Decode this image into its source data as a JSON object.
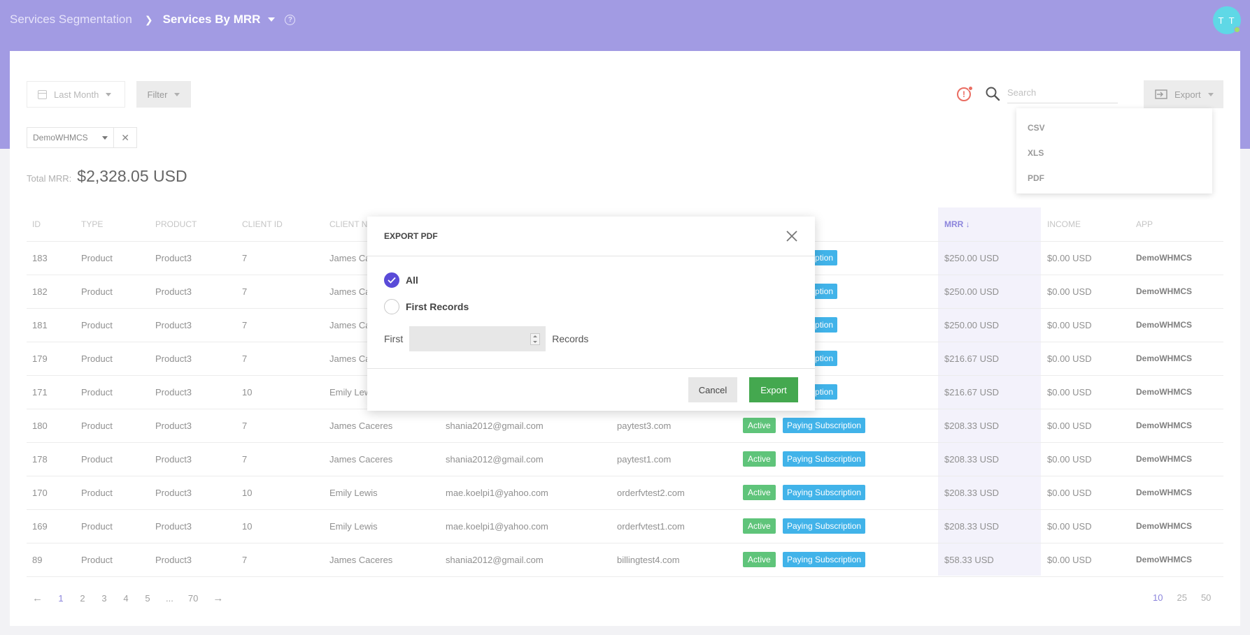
{
  "header": {
    "breadcrumb_parent": "Services Segmentation",
    "breadcrumb_current": "Services By MRR",
    "avatar_initials": "T T"
  },
  "toolbar": {
    "date_range": "Last Month",
    "filter_label": "Filter",
    "search_placeholder": "Search",
    "export_label": "Export",
    "export_options": [
      "CSV",
      "XLS",
      "PDF"
    ]
  },
  "filter_tag": {
    "label": "DemoWHMCS"
  },
  "summary": {
    "total_label": "Total MRR:",
    "total_value": "$2,328.05 USD"
  },
  "table": {
    "columns": [
      "ID",
      "TYPE",
      "PRODUCT",
      "CLIENT ID",
      "CLIENT N",
      "",
      "",
      "",
      "MRR",
      "INCOME",
      "APP"
    ],
    "rows": [
      [
        "183",
        "Product",
        "Product3",
        "7",
        "James Ca",
        "",
        "",
        "",
        "Subscription",
        "$250.00 USD",
        "$0.00 USD",
        "DemoWHMCS"
      ],
      [
        "182",
        "Product",
        "Product3",
        "7",
        "James Ca",
        "",
        "",
        "",
        "Subscription",
        "$250.00 USD",
        "$0.00 USD",
        "DemoWHMCS"
      ],
      [
        "181",
        "Product",
        "Product3",
        "7",
        "James Ca",
        "",
        "",
        "",
        "Subscription",
        "$250.00 USD",
        "$0.00 USD",
        "DemoWHMCS"
      ],
      [
        "179",
        "Product",
        "Product3",
        "7",
        "James Ca",
        "",
        "",
        "",
        "Subscription",
        "$216.67 USD",
        "$0.00 USD",
        "DemoWHMCS"
      ],
      [
        "171",
        "Product",
        "Product3",
        "10",
        "Emily Lew",
        "",
        "",
        "",
        "Subscription",
        "$216.67 USD",
        "$0.00 USD",
        "DemoWHMCS"
      ],
      [
        "180",
        "Product",
        "Product3",
        "7",
        "James Caceres",
        "shania2012@gmail.com",
        "paytest3.com",
        "Active",
        "Paying Subscription",
        "$208.33 USD",
        "$0.00 USD",
        "DemoWHMCS"
      ],
      [
        "178",
        "Product",
        "Product3",
        "7",
        "James Caceres",
        "shania2012@gmail.com",
        "paytest1.com",
        "Active",
        "Paying Subscription",
        "$208.33 USD",
        "$0.00 USD",
        "DemoWHMCS"
      ],
      [
        "170",
        "Product",
        "Product3",
        "10",
        "Emily Lewis",
        "mae.koelpi1@yahoo.com",
        "orderfvtest2.com",
        "Active",
        "Paying Subscription",
        "$208.33 USD",
        "$0.00 USD",
        "DemoWHMCS"
      ],
      [
        "169",
        "Product",
        "Product3",
        "10",
        "Emily Lewis",
        "mae.koelpi1@yahoo.com",
        "orderfvtest1.com",
        "Active",
        "Paying Subscription",
        "$208.33 USD",
        "$0.00 USD",
        "DemoWHMCS"
      ],
      [
        "89",
        "Product",
        "Product3",
        "7",
        "James Caceres",
        "shania2012@gmail.com",
        "billingtest4.com",
        "Active",
        "Paying Subscription",
        "$58.33 USD",
        "$0.00 USD",
        "DemoWHMCS"
      ]
    ]
  },
  "pagination": {
    "prev": "←",
    "pages": [
      "1",
      "2",
      "3",
      "4",
      "5",
      "...",
      "70"
    ],
    "next": "→",
    "page_sizes": [
      "10",
      "25",
      "50"
    ]
  },
  "modal": {
    "title": "EXPORT PDF",
    "option_all": "All",
    "option_first": "First Records",
    "first_prefix": "First",
    "first_suffix": "Records",
    "cancel_label": "Cancel",
    "confirm_label": "Export"
  },
  "colors": {
    "accent": "#a29be3",
    "primary": "#5a4bd8",
    "active_badge": "#5fc47a",
    "subscription_badge": "#41b3e9",
    "export_button": "#44a84f"
  }
}
